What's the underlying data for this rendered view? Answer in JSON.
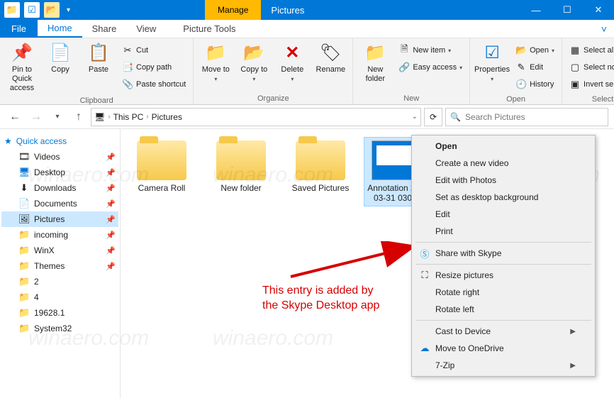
{
  "titlebar": {
    "contextual_tab": "Manage",
    "window_title": "Pictures"
  },
  "ribbon_tabs": {
    "file": "File",
    "home": "Home",
    "share": "Share",
    "view": "View",
    "picture_tools": "Picture Tools"
  },
  "ribbon": {
    "pin": "Pin to Quick access",
    "copy": "Copy",
    "paste": "Paste",
    "cut": "Cut",
    "copy_path": "Copy path",
    "paste_shortcut": "Paste shortcut",
    "clipboard_label": "Clipboard",
    "move_to": "Move to",
    "copy_to": "Copy to",
    "delete": "Delete",
    "rename": "Rename",
    "organize_label": "Organize",
    "new_folder": "New folder",
    "new_item": "New item",
    "easy_access": "Easy access",
    "new_label": "New",
    "properties": "Properties",
    "open": "Open",
    "edit": "Edit",
    "history": "History",
    "open_label": "Open",
    "select_all": "Select all",
    "select_none": "Select none",
    "invert": "Invert selection",
    "select_label": "Select"
  },
  "address": {
    "this_pc": "This PC",
    "folder": "Pictures"
  },
  "search": {
    "placeholder": "Search Pictures"
  },
  "sidebar": {
    "quick_access": "Quick access",
    "items": [
      {
        "label": "Videos"
      },
      {
        "label": "Desktop"
      },
      {
        "label": "Downloads"
      },
      {
        "label": "Documents"
      },
      {
        "label": "Pictures"
      },
      {
        "label": "incoming"
      },
      {
        "label": "WinX"
      },
      {
        "label": "Themes"
      },
      {
        "label": "2"
      },
      {
        "label": "4"
      },
      {
        "label": "19628.1"
      },
      {
        "label": "System32"
      }
    ]
  },
  "files": [
    {
      "label": "Camera Roll",
      "type": "folder"
    },
    {
      "label": "New folder",
      "type": "folder"
    },
    {
      "label": "Saved Pictures",
      "type": "folder"
    },
    {
      "label": "Annotation 2020-03-31 030436",
      "type": "image"
    }
  ],
  "context_menu": {
    "open": "Open",
    "create_video": "Create a new video",
    "edit_photos": "Edit with Photos",
    "set_bg": "Set as desktop background",
    "edit": "Edit",
    "print": "Print",
    "share_skype": "Share with Skype",
    "resize": "Resize pictures",
    "rotate_right": "Rotate right",
    "rotate_left": "Rotate left",
    "cast": "Cast to Device",
    "onedrive": "Move to OneDrive",
    "sevenzip": "7-Zip"
  },
  "annotation": {
    "line1": "This entry is added by",
    "line2": "the Skype Desktop app"
  },
  "watermark": "winaero.com"
}
